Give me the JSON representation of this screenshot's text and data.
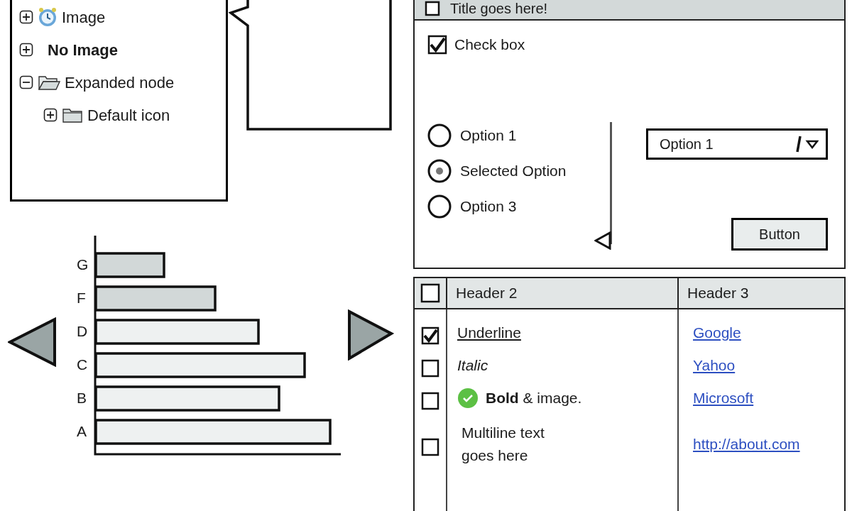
{
  "tree": {
    "items": [
      {
        "label": "Image",
        "kind": "image",
        "expanded": false
      },
      {
        "label": "No Image",
        "kind": "plain",
        "expanded": false
      },
      {
        "label": "Expanded node",
        "kind": "folder",
        "expanded": true,
        "children": [
          {
            "label": "Default icon",
            "kind": "folder",
            "expanded": false
          }
        ]
      }
    ]
  },
  "window": {
    "title": "Title goes here!",
    "title_checked": false,
    "checkbox": {
      "label": "Check box",
      "checked": true
    },
    "radios": [
      {
        "label": "Option 1",
        "selected": false
      },
      {
        "label": "Selected Option",
        "selected": true
      },
      {
        "label": "Option 3",
        "selected": false
      }
    ],
    "slider": {
      "level": 0
    },
    "dropdown": {
      "value": "Option 1"
    },
    "button": "Button"
  },
  "chart": {
    "bar_labels": [
      "G",
      "F",
      "D",
      "C",
      "B",
      "A"
    ]
  },
  "table": {
    "header_checked": false,
    "columns": [
      "Header 2",
      "Header 3"
    ],
    "rows": [
      {
        "checked": true,
        "kind": "underline",
        "text": "Underline",
        "link": "Google"
      },
      {
        "checked": false,
        "kind": "italic",
        "text": "Italic",
        "link": "Yahoo"
      },
      {
        "checked": false,
        "kind": "image",
        "text": "**Bold** & image.",
        "link": "Microsoft"
      },
      {
        "checked": false,
        "kind": "multiline",
        "text": "Multiline text goes here",
        "link": "http://about.com"
      }
    ]
  }
}
